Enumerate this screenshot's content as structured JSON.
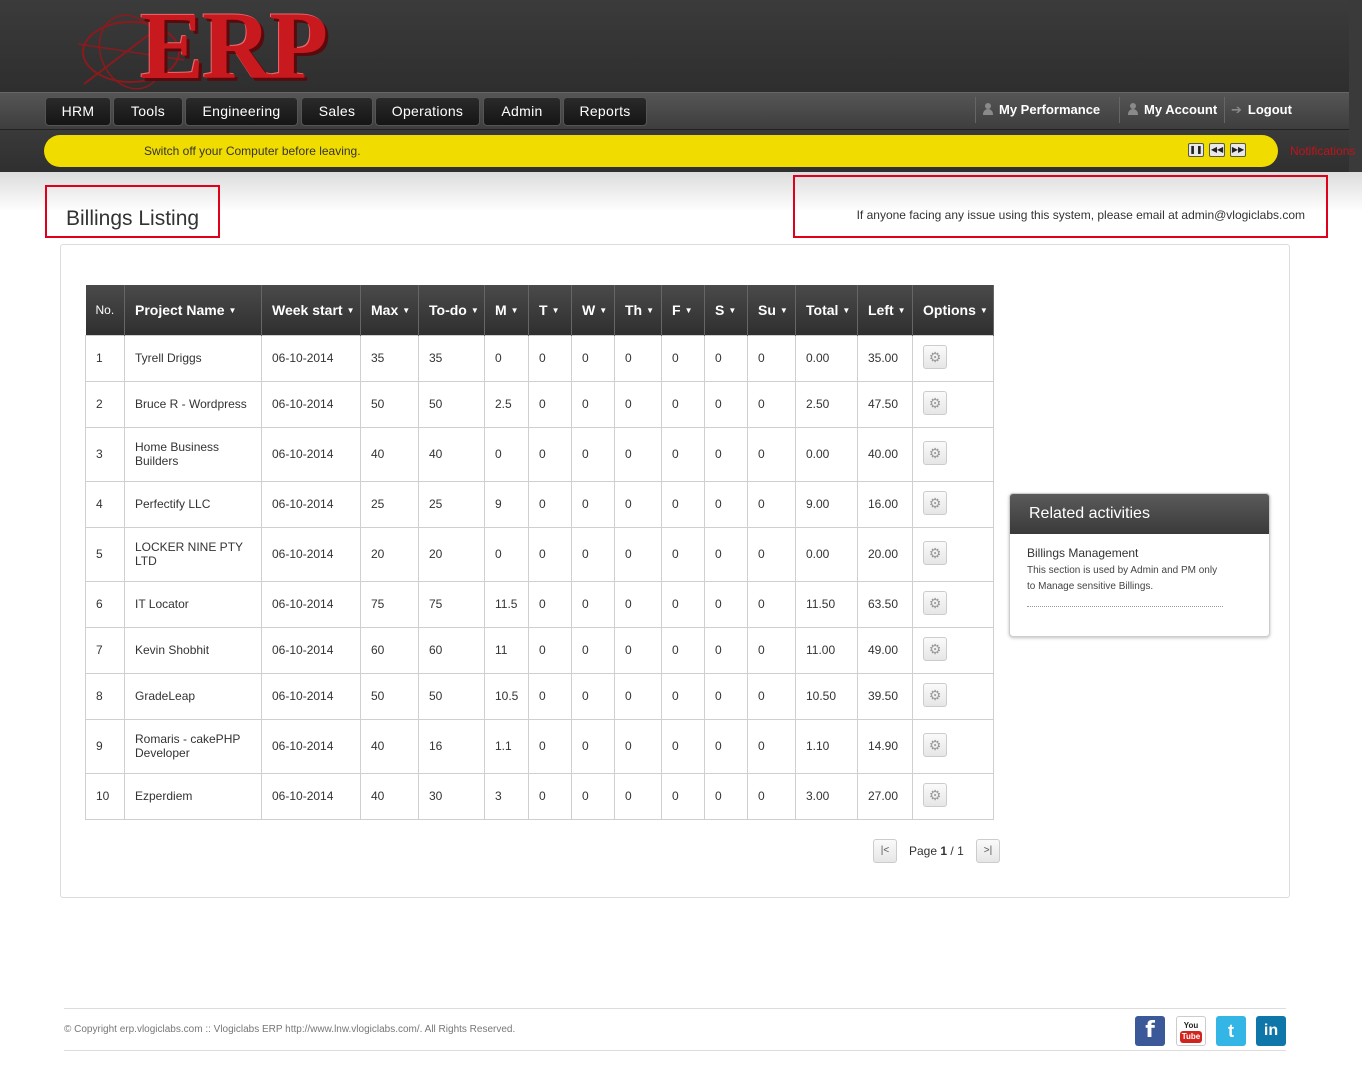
{
  "brand": {
    "logo_text": "ERP"
  },
  "nav": {
    "items": [
      "HRM",
      "Tools",
      "Engineering",
      "Sales",
      "Operations",
      "Admin",
      "Reports"
    ],
    "right": {
      "performance": "My Performance",
      "account": "My Account",
      "logout": "Logout"
    }
  },
  "ticker": {
    "message": "Switch off your Computer before leaving.",
    "notifications_label": "Notifications"
  },
  "page": {
    "title": "Billings Listing",
    "help_text": "If anyone facing any issue using this system, please email at admin@vlogiclabs.com"
  },
  "table": {
    "columns": [
      "No.",
      "Project Name",
      "Week start",
      "Max",
      "To-do",
      "M",
      "T",
      "W",
      "Th",
      "F",
      "S",
      "Su",
      "Total",
      "Left",
      "Options"
    ],
    "rows": [
      [
        "1",
        "Tyrell Driggs",
        "06-10-2014",
        "35",
        "35",
        "0",
        "0",
        "0",
        "0",
        "0",
        "0",
        "0",
        "0.00",
        "35.00"
      ],
      [
        "2",
        "Bruce R - Wordpress",
        "06-10-2014",
        "50",
        "50",
        "2.5",
        "0",
        "0",
        "0",
        "0",
        "0",
        "0",
        "2.50",
        "47.50"
      ],
      [
        "3",
        "Home Business Builders",
        "06-10-2014",
        "40",
        "40",
        "0",
        "0",
        "0",
        "0",
        "0",
        "0",
        "0",
        "0.00",
        "40.00"
      ],
      [
        "4",
        "Perfectify LLC",
        "06-10-2014",
        "25",
        "25",
        "9",
        "0",
        "0",
        "0",
        "0",
        "0",
        "0",
        "9.00",
        "16.00"
      ],
      [
        "5",
        "LOCKER NINE PTY LTD",
        "06-10-2014",
        "20",
        "20",
        "0",
        "0",
        "0",
        "0",
        "0",
        "0",
        "0",
        "0.00",
        "20.00"
      ],
      [
        "6",
        "IT Locator",
        "06-10-2014",
        "75",
        "75",
        "11.5",
        "0",
        "0",
        "0",
        "0",
        "0",
        "0",
        "11.50",
        "63.50"
      ],
      [
        "7",
        "Kevin Shobhit",
        "06-10-2014",
        "60",
        "60",
        "11",
        "0",
        "0",
        "0",
        "0",
        "0",
        "0",
        "11.00",
        "49.00"
      ],
      [
        "8",
        "GradeLeap",
        "06-10-2014",
        "50",
        "50",
        "10.5",
        "0",
        "0",
        "0",
        "0",
        "0",
        "0",
        "10.50",
        "39.50"
      ],
      [
        "9",
        "Romaris - cakePHP Developer",
        "06-10-2014",
        "40",
        "16",
        "1.1",
        "0",
        "0",
        "0",
        "0",
        "0",
        "0",
        "1.10",
        "14.90"
      ],
      [
        "10",
        "Ezperdiem",
        "06-10-2014",
        "40",
        "30",
        "3",
        "0",
        "0",
        "0",
        "0",
        "0",
        "0",
        "3.00",
        "27.00"
      ]
    ]
  },
  "pagination": {
    "prefix": "Page ",
    "current": "1",
    "separator": " / ",
    "total": "1"
  },
  "related": {
    "title": "Related activities",
    "link": "Billings Management",
    "description": "This section is used by Admin and PM only to Manage sensitive Billings."
  },
  "footer": {
    "copyright": "© Copyright erp.vlogiclabs.com :: Vlogiclabs ERP http://www.lnw.vlogiclabs.com/. All Rights Reserved.",
    "social": [
      "facebook-icon",
      "youtube-icon",
      "twitter-icon",
      "linkedin-icon"
    ]
  },
  "colors": {
    "accent_red": "#c8191f",
    "highlight_box": "#e0001b",
    "ticker_yellow": "#f1dc00",
    "header_dark": "#3a3a3a"
  }
}
